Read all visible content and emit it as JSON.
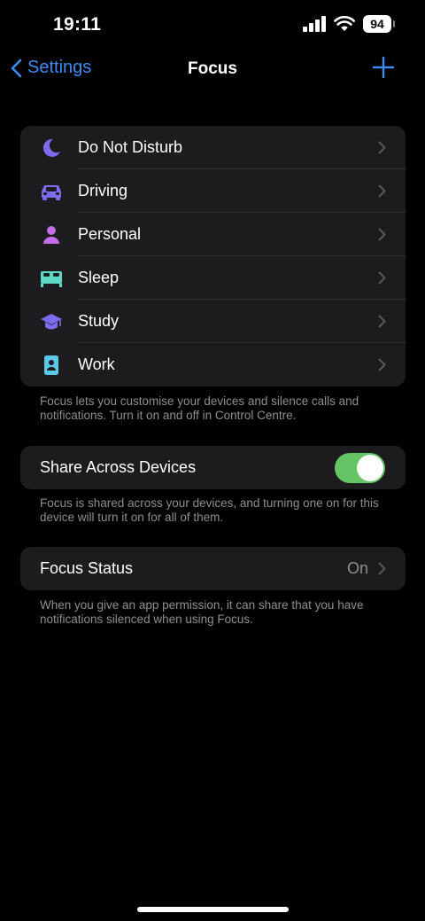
{
  "status_bar": {
    "time": "19:11",
    "battery": "94"
  },
  "nav": {
    "back_label": "Settings",
    "title": "Focus"
  },
  "focus_modes": [
    {
      "label": "Do Not Disturb",
      "icon": "moon-icon",
      "color": "#7d6cf0"
    },
    {
      "label": "Driving",
      "icon": "car-icon",
      "color": "#7d6cf0"
    },
    {
      "label": "Personal",
      "icon": "person-icon",
      "color": "#c56ce8"
    },
    {
      "label": "Sleep",
      "icon": "bed-icon",
      "color": "#5fd8c6"
    },
    {
      "label": "Study",
      "icon": "graduation-cap-icon",
      "color": "#7d6cf0"
    },
    {
      "label": "Work",
      "icon": "id-badge-icon",
      "color": "#5ac8e6"
    }
  ],
  "focus_footnote": "Focus lets you customise your devices and silence calls and notifications. Turn it on and off in Control Centre.",
  "share": {
    "label": "Share Across Devices",
    "enabled": true,
    "footnote": "Focus is shared across your devices, and turning one on for this device will turn it on for all of them."
  },
  "focus_status": {
    "label": "Focus Status",
    "value": "On",
    "footnote": "When you give an app permission, it can share that you have notifications silenced when using Focus."
  },
  "colors": {
    "accent": "#3f8bf2",
    "toggle_on": "#65c466",
    "cell_bg": "#1c1c1e",
    "secondary_text": "#8e8e93"
  }
}
